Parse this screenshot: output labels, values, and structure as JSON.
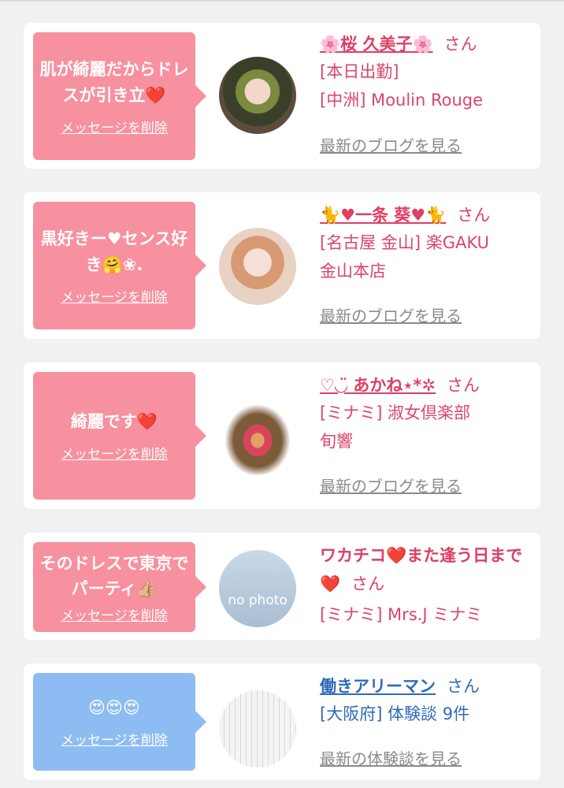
{
  "cards": [
    {
      "message": "肌が綺麗だからドレスが引き立❤️",
      "delete_label": "メッセージを削除",
      "name": "🌸桜 久美子🌸",
      "suffix": "さん",
      "lines": [
        "[本日出勤]",
        "[中洲] Moulin Rouge"
      ],
      "link": "最新のブログを見る"
    },
    {
      "message": "黒好きー♥センス好き🤗❀.",
      "delete_label": "メッセージを削除",
      "name": "🐈♥一条 葵♥🐈",
      "suffix": "さん",
      "lines": [
        "[名古屋 金山] 楽GAKU",
        "金山本店"
      ],
      "link": "最新のブログを見る"
    },
    {
      "message": "綺麗です❤️",
      "delete_label": "メッセージを削除",
      "name": "♡◡̈ あかね⋆*✲",
      "suffix": "さん",
      "lines": [
        "[ミナミ] 淑女倶楽部",
        "旬響"
      ],
      "link": "最新のブログを見る"
    },
    {
      "message": "そのドレスで東京でパーティ👍🏼",
      "delete_label": "メッセージを削除",
      "name": "ワカチコ❤️また逢う日まで❤️",
      "suffix": "さん",
      "lines": [
        "[ミナミ] Mrs.J ミナミ"
      ],
      "avatar_text": "no photo"
    },
    {
      "message": "😍😍😍",
      "delete_label": "メッセージを削除",
      "name": "働きアリーマン",
      "suffix": "さん",
      "lines": [
        "[大阪府] 体験談 9件"
      ],
      "link": "最新の体験談を見る"
    }
  ]
}
